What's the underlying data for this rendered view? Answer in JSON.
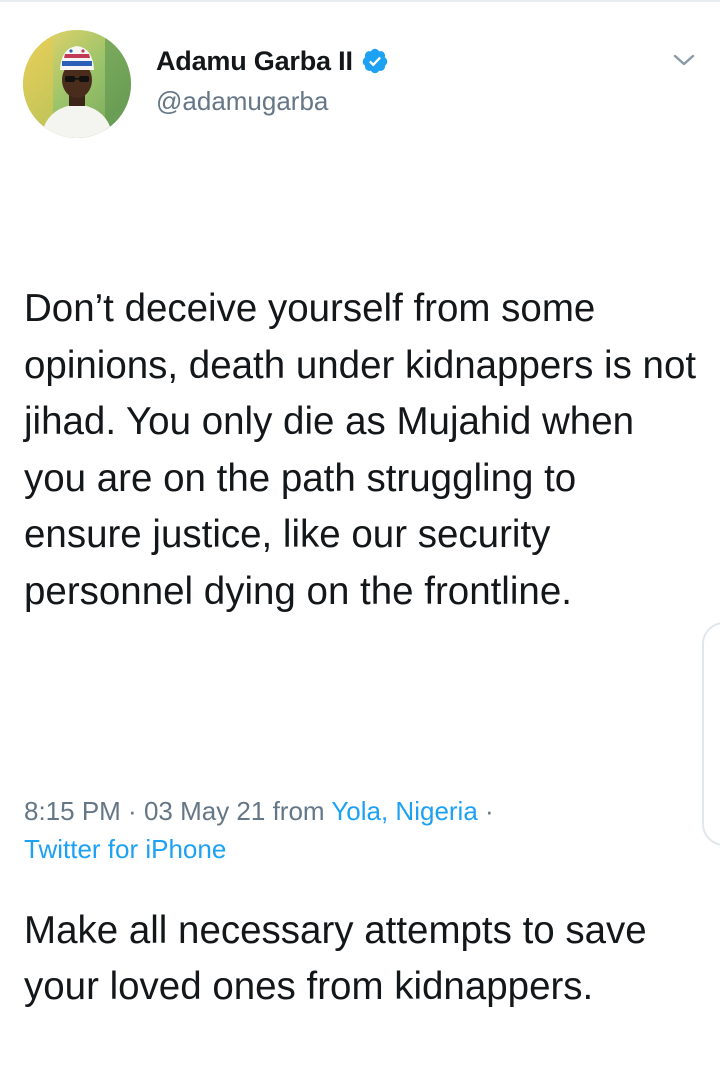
{
  "tweet": {
    "display_name": "Adamu Garba II",
    "handle": "@adamugarba",
    "verified_icon": "verified-badge-icon",
    "paragraphs": [
      "Don’t deceive yourself from some opinions, death under kidnappers is not jihad. You only die as Mujahid when you are on the path struggling to ensure justice, like our security personnel dying on the frontline.",
      "Make all necessary attempts to save your loved ones from kidnappers."
    ],
    "meta": {
      "time": "8:15 PM",
      "separator": " · ",
      "date": "03 May 21",
      "from": " from ",
      "location": "Yola, Nigeria",
      "source": "Twitter for iPhone"
    }
  },
  "colors": {
    "text": "#14171a",
    "secondary": "#657786",
    "link": "#1da1f2"
  },
  "icons": {
    "menu": "chevron-down-icon",
    "avatar": "avatar"
  }
}
